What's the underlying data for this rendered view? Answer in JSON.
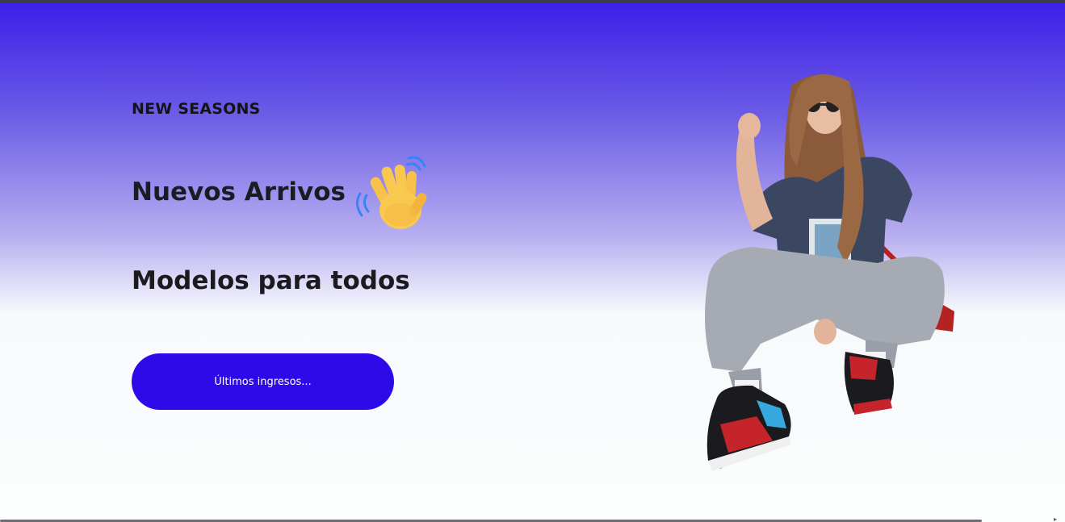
{
  "hero": {
    "eyebrow": "NEW SEASONS",
    "headline": "Nuevos Arrivos",
    "subheadline": "Modelos para todos",
    "cta_label": "Últimos ingresos...",
    "hand_icon": "waving-hand-icon",
    "image": "model-photo"
  },
  "colors": {
    "gradient_top": "#3c1de8",
    "button": "#2f0ae8",
    "text": "#1c1b22",
    "background": "#fafffd"
  }
}
